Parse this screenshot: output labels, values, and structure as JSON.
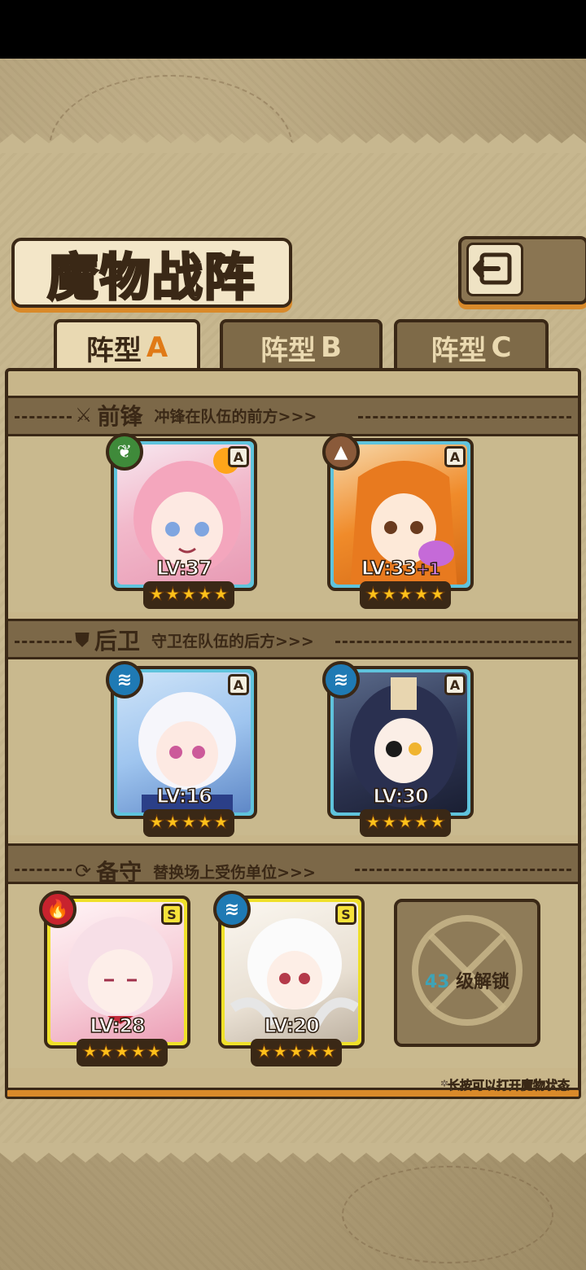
{
  "title": "魔物战阵",
  "tabs": [
    {
      "prefix": "阵型",
      "letter": "A",
      "active": true
    },
    {
      "prefix": "阵型",
      "letter": "B",
      "active": false
    },
    {
      "prefix": "阵型",
      "letter": "C",
      "active": false
    }
  ],
  "sections": {
    "front": {
      "name": "前锋",
      "desc": "冲锋在队伍的前方>>>"
    },
    "back": {
      "name": "后卫",
      "desc": "守卫在队伍的后方>>>"
    },
    "reserve": {
      "name": "备守",
      "desc": "替换场上受伤单位>>>"
    }
  },
  "units": {
    "front1": {
      "rank": "A",
      "element": "leaf-icon",
      "level": "LV:37",
      "stars": 5
    },
    "front2": {
      "rank": "A",
      "element": "mountain-icon",
      "level": "LV:33",
      "bonus": "+1",
      "stars": 5
    },
    "back1": {
      "rank": "A",
      "element": "water-icon",
      "level": "LV:16",
      "stars": 5
    },
    "back2": {
      "rank": "A",
      "element": "water-icon",
      "level": "LV:30",
      "stars": 5
    },
    "reserve1": {
      "rank": "S",
      "element": "fire-icon",
      "level": "LV:28",
      "stars": 5
    },
    "reserve2": {
      "rank": "S",
      "element": "water-icon",
      "level": "LV:20",
      "stars": 5
    }
  },
  "locked_slot": {
    "level": "43",
    "text": "级解锁"
  },
  "hint": "*长按可以打开魔物状态",
  "colors": {
    "blue_frame": "#5fc3dc",
    "yellow_frame": "#f0e12a",
    "accent_orange": "#e07a17",
    "border_dark": "#3a2816"
  },
  "icons": {
    "back": "back-arrow-icon"
  }
}
